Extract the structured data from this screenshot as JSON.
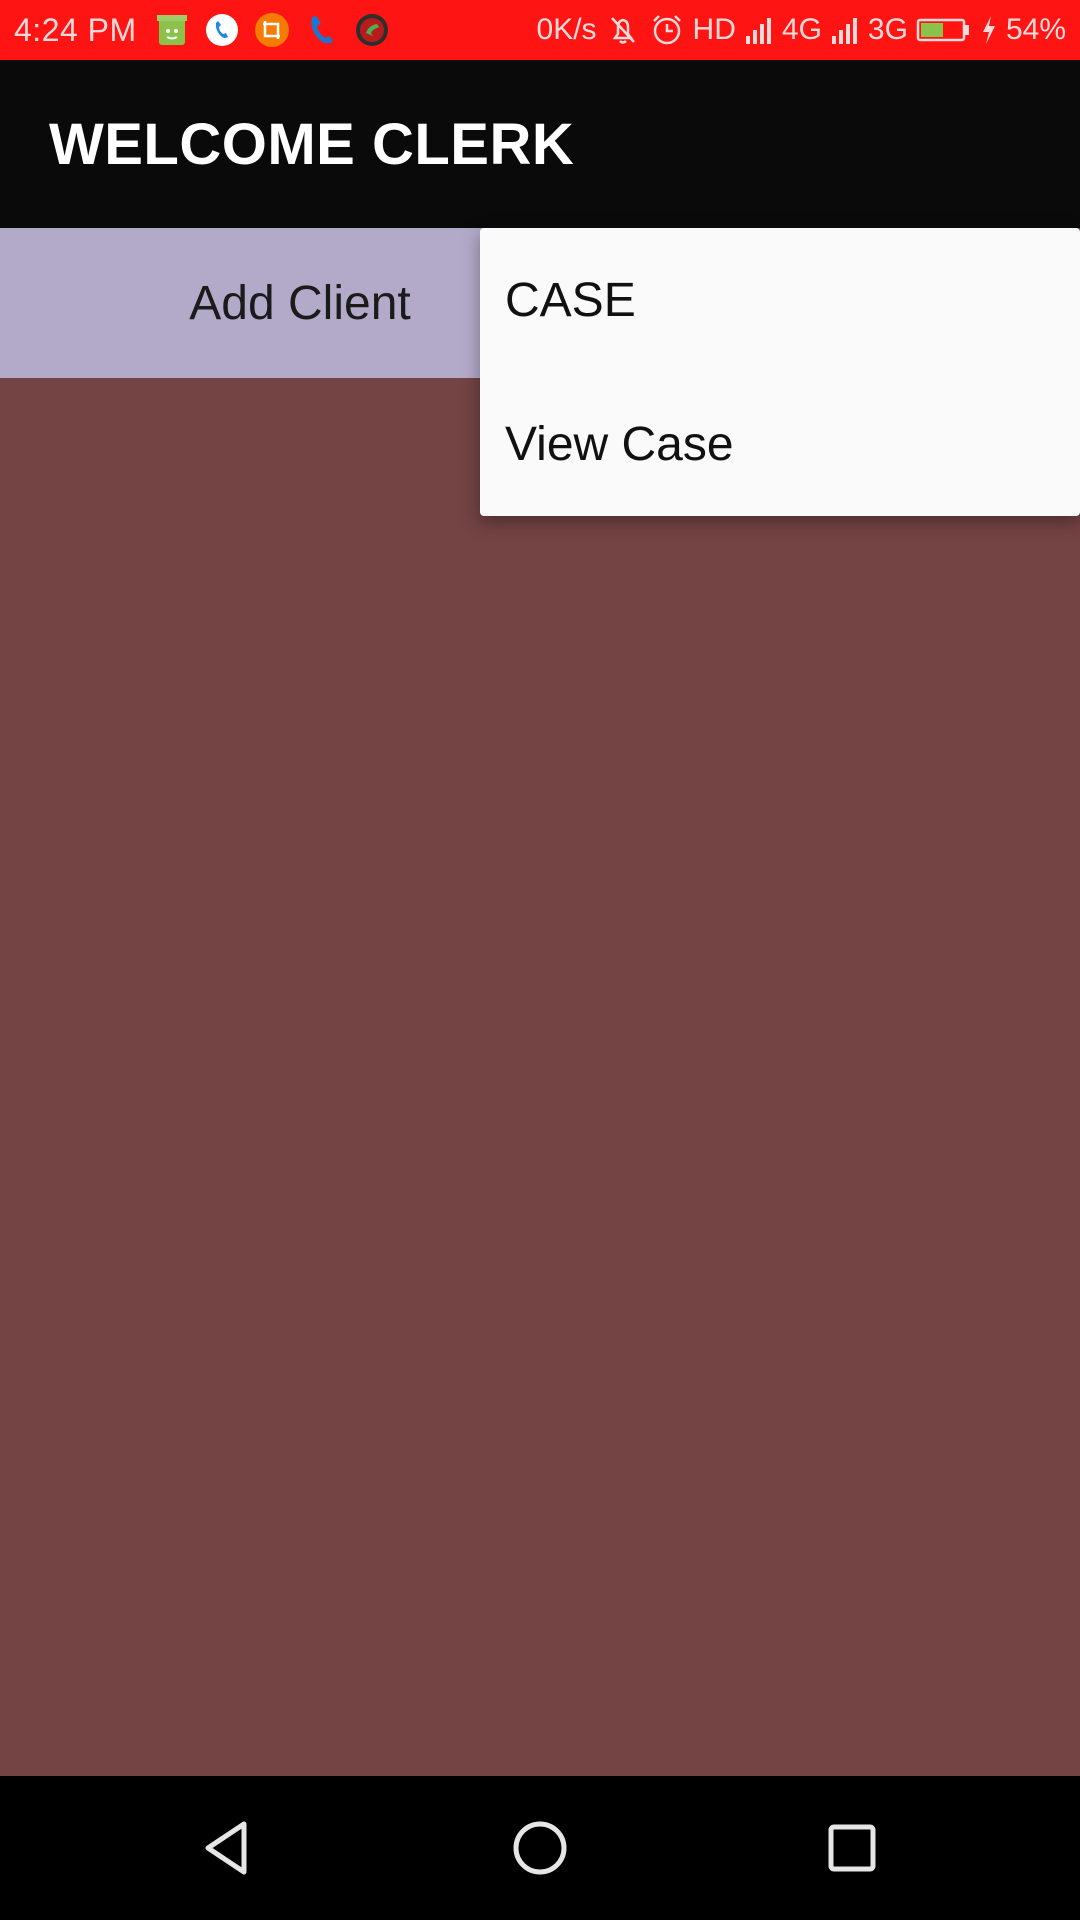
{
  "status_bar": {
    "time": "4:24 PM",
    "network_speed": "0K/s",
    "hd_label": "HD",
    "network_4g": "4G",
    "network_3g": "3G",
    "battery_percent": "54%",
    "battery_level": 0.54,
    "notification_icons": [
      "cleaner-app-icon",
      "phone-call-icon",
      "crop-app-icon",
      "phone-icon",
      "call-recorder-icon"
    ],
    "colors": {
      "background": "#ff1414",
      "text": "#fbd9d9"
    }
  },
  "app_bar": {
    "title": "WELCOME CLERK",
    "background": "#0a0a0a"
  },
  "content": {
    "add_client_label": "Add Client",
    "button_color": "#b3aaca",
    "background": "#744343"
  },
  "popup_menu": {
    "items": [
      {
        "label": "CASE"
      },
      {
        "label": "View Case"
      }
    ]
  },
  "nav_bar": {
    "buttons": [
      "back-icon",
      "home-icon",
      "recents-icon"
    ]
  }
}
